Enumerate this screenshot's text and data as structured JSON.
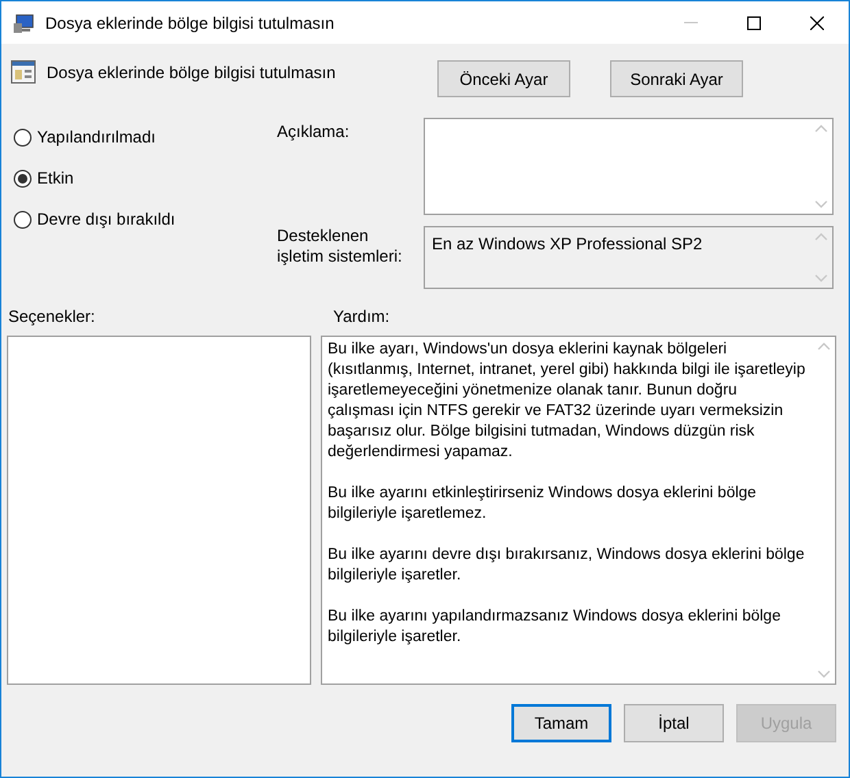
{
  "window": {
    "title": "Dosya eklerinde bölge bilgisi tutulmasın"
  },
  "policy": {
    "title": "Dosya eklerinde bölge bilgisi tutulmasın"
  },
  "nav_buttons": [
    "Önceki Ayar",
    "Sonraki Ayar"
  ],
  "options": [
    {
      "label": "Yapılandırılmadı",
      "selected": false
    },
    {
      "label": "Etkin",
      "selected": true
    },
    {
      "label": "Devre dışı bırakıldı",
      "selected": false
    }
  ],
  "comment": {
    "label": "Açıklama:"
  },
  "supported": {
    "label": "Desteklenen işletim sistemleri:",
    "value": "En az Windows XP Professional SP2"
  },
  "options_label": "Seçenekler:",
  "help": {
    "label": "Yardım:",
    "paragraphs": [
      "Bu ilke ayarı, Windows'un dosya eklerini kaynak bölgeleri (kısıtlanmış, Internet, intranet, yerel gibi) hakkında bilgi ile işaretleyip işaretlemeyeceğini yönetmenize olanak tanır. Bunun doğru çalışması için NTFS gerekir ve FAT32 üzerinde uyarı vermeksizin başarısız olur. Bölge bilgisini tutmadan, Windows düzgün risk değerlendirmesi yapamaz.",
      "Bu ilke ayarını etkinleştirirseniz Windows dosya eklerini bölge bilgileriyle işaretlemez.",
      "Bu ilke ayarını devre dışı bırakırsanız, Windows dosya eklerini bölge bilgileriyle işaretler.",
      "Bu ilke ayarını yapılandırmazsanız Windows dosya eklerini bölge bilgileriyle işaretler."
    ]
  },
  "buttons": [
    {
      "label": "Tamam",
      "default": true,
      "disabled": false
    },
    {
      "label": "İptal",
      "default": false,
      "disabled": false
    },
    {
      "label": "Uygula",
      "default": false,
      "disabled": true
    }
  ]
}
